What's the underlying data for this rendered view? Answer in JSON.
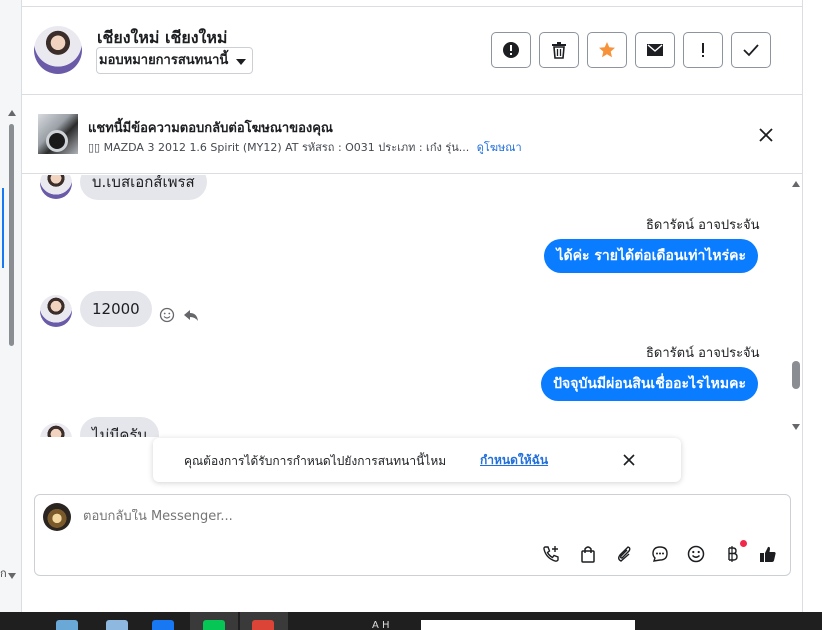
{
  "header": {
    "contact_name": "เชียงใหม่ เชียงใหม่",
    "assign_label": "มอบหมายการสนทนานี้",
    "actions": [
      {
        "name": "report-spam-button",
        "icon": "alert-circle-icon"
      },
      {
        "name": "delete-button",
        "icon": "trash-icon"
      },
      {
        "name": "star-button",
        "icon": "star-icon",
        "color": "#f7923a"
      },
      {
        "name": "mark-unread-button",
        "icon": "envelope-icon"
      },
      {
        "name": "follow-up-button",
        "icon": "exclamation-icon"
      },
      {
        "name": "mark-done-button",
        "icon": "checkmark-icon"
      }
    ]
  },
  "ad_banner": {
    "title": "แชทนี้มีข้อความตอบกลับต่อโฆษณาของคุณ",
    "description": "▯▯ MAZDA 3 2012 1.6 Spirit (MY12) AT รหัสรถ : O031 ประเภท : เก๋ง รุ่น...",
    "link_label": "ดูโฆษณา"
  },
  "messages": [
    {
      "direction": "in",
      "text": "บ.เบสเอกส์เพรส"
    },
    {
      "direction": "out",
      "sender": "ธิดารัตน์ อาจประจัน",
      "text": "ได้ค่ะ รายได้ต่อเดือนเท่าไหร่คะ"
    },
    {
      "direction": "in",
      "text": "12000"
    },
    {
      "direction": "out",
      "sender": "ธิดารัตน์ อาจประจัน",
      "text": "ปัจจุบันมีผ่อนสินเชื่ออะไรไหมคะ"
    },
    {
      "direction": "in",
      "text": "ไม่มีครับ"
    }
  ],
  "toast": {
    "text": "คุณต้องการได้รับการกำหนดไปยังการสนทนานี้ไหม",
    "link_label": "กำหนดให้ฉัน"
  },
  "composer": {
    "placeholder": "ตอบกลับใน Messenger...",
    "tools": [
      "call-icon",
      "shopping-bag-icon",
      "paperclip-icon",
      "saved-reply-icon",
      "emoji-icon",
      "baht-icon",
      "thumbs-up-icon"
    ]
  },
  "colors": {
    "accent": "#0a7cff",
    "link": "#216fdb",
    "star": "#f7923a",
    "notification_dot": "#f02849"
  },
  "left_strip_letter": "ก",
  "taskbar_text": "A        H"
}
